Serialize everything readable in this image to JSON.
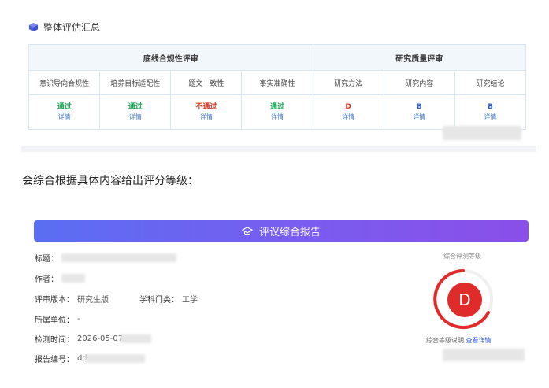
{
  "section": {
    "title": "整体评估汇总"
  },
  "table": {
    "groups": [
      "底线合规性评审",
      "研究质量评审"
    ],
    "columns": [
      "意识导向合规性",
      "培养目标适配性",
      "题文一致性",
      "事实准确性",
      "研究方法",
      "研究内容",
      "研究结论"
    ],
    "results": [
      "通过",
      "通过",
      "不通过",
      "通过",
      "D",
      "B",
      "B"
    ],
    "detail": "详情"
  },
  "mid_text": "会综合根据具体内容给出评分等级：",
  "report": {
    "banner": "评议综合报告",
    "title_label": "标题：",
    "title_value": "",
    "author_label": "作者：",
    "version_label": "评审版本：",
    "version_value": "研究生版",
    "subject_label": "学科门类：",
    "subject_value": "工学",
    "unit_label": "所属单位：",
    "unit_value": "-",
    "time_label": "检测时间：",
    "time_value": "2026-05-07",
    "code_label": "报告编号：",
    "code_value": "dd",
    "grade_title": "综合评测等级",
    "grade": "D",
    "grade_desc": "综合等级说明",
    "grade_link": "查看详情"
  },
  "colors": {
    "pass": "#1aaa55",
    "fail": "#e0321c",
    "gradeB": "#2f5fd0",
    "accent": "#6b63f0"
  }
}
